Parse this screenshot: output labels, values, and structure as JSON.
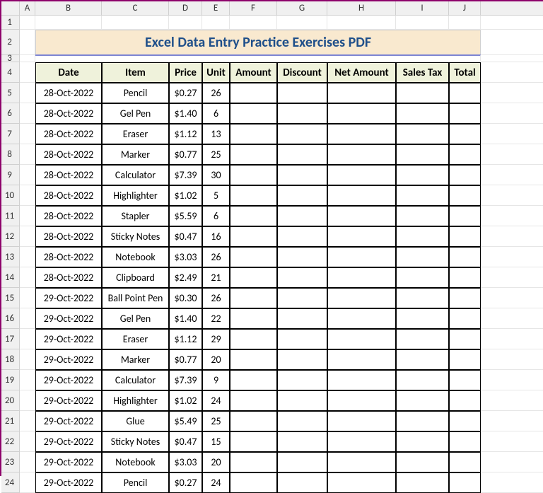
{
  "columns": [
    "A",
    "B",
    "C",
    "D",
    "E",
    "F",
    "G",
    "H",
    "I",
    "J"
  ],
  "title": "Excel Data Entry Practice Exercises PDF",
  "headers": [
    "Date",
    "Item",
    "Price",
    "Unit",
    "Amount",
    "Discount",
    "Net Amount",
    "Sales Tax",
    "Total"
  ],
  "rows": [
    {
      "n": 5,
      "date": "28-Oct-2022",
      "item": "Pencil",
      "price": "$0.27",
      "unit": "26"
    },
    {
      "n": 6,
      "date": "28-Oct-2022",
      "item": "Gel Pen",
      "price": "$1.40",
      "unit": "6"
    },
    {
      "n": 7,
      "date": "28-Oct-2022",
      "item": "Eraser",
      "price": "$1.12",
      "unit": "13"
    },
    {
      "n": 8,
      "date": "28-Oct-2022",
      "item": "Marker",
      "price": "$0.77",
      "unit": "25"
    },
    {
      "n": 9,
      "date": "28-Oct-2022",
      "item": "Calculator",
      "price": "$7.39",
      "unit": "30"
    },
    {
      "n": 10,
      "date": "28-Oct-2022",
      "item": "Highlighter",
      "price": "$1.02",
      "unit": "5"
    },
    {
      "n": 11,
      "date": "28-Oct-2022",
      "item": "Stapler",
      "price": "$5.59",
      "unit": "6"
    },
    {
      "n": 12,
      "date": "28-Oct-2022",
      "item": "Sticky Notes",
      "price": "$0.47",
      "unit": "16"
    },
    {
      "n": 13,
      "date": "28-Oct-2022",
      "item": "Notebook",
      "price": "$3.03",
      "unit": "26"
    },
    {
      "n": 14,
      "date": "28-Oct-2022",
      "item": "Clipboard",
      "price": "$2.49",
      "unit": "21"
    },
    {
      "n": 15,
      "date": "29-Oct-2022",
      "item": "Ball Point Pen",
      "price": "$0.30",
      "unit": "26"
    },
    {
      "n": 16,
      "date": "29-Oct-2022",
      "item": "Gel Pen",
      "price": "$1.40",
      "unit": "22"
    },
    {
      "n": 17,
      "date": "29-Oct-2022",
      "item": "Eraser",
      "price": "$1.12",
      "unit": "29"
    },
    {
      "n": 18,
      "date": "29-Oct-2022",
      "item": "Marker",
      "price": "$0.77",
      "unit": "20"
    },
    {
      "n": 19,
      "date": "29-Oct-2022",
      "item": "Calculator",
      "price": "$7.39",
      "unit": "9"
    },
    {
      "n": 20,
      "date": "29-Oct-2022",
      "item": "Highlighter",
      "price": "$1.02",
      "unit": "24"
    },
    {
      "n": 21,
      "date": "29-Oct-2022",
      "item": "Glue",
      "price": "$5.49",
      "unit": "25"
    },
    {
      "n": 22,
      "date": "29-Oct-2022",
      "item": "Sticky Notes",
      "price": "$0.47",
      "unit": "15"
    },
    {
      "n": 23,
      "date": "29-Oct-2022",
      "item": "Notebook",
      "price": "$3.03",
      "unit": "20"
    },
    {
      "n": 24,
      "date": "29-Oct-2022",
      "item": "Pencil",
      "price": "$0.27",
      "unit": "24"
    }
  ],
  "chart_data": {
    "type": "table",
    "title": "Excel Data Entry Practice Exercises PDF",
    "columns": [
      "Date",
      "Item",
      "Price",
      "Unit",
      "Amount",
      "Discount",
      "Net Amount",
      "Sales Tax",
      "Total"
    ],
    "data": [
      [
        "28-Oct-2022",
        "Pencil",
        0.27,
        26,
        null,
        null,
        null,
        null,
        null
      ],
      [
        "28-Oct-2022",
        "Gel Pen",
        1.4,
        6,
        null,
        null,
        null,
        null,
        null
      ],
      [
        "28-Oct-2022",
        "Eraser",
        1.12,
        13,
        null,
        null,
        null,
        null,
        null
      ],
      [
        "28-Oct-2022",
        "Marker",
        0.77,
        25,
        null,
        null,
        null,
        null,
        null
      ],
      [
        "28-Oct-2022",
        "Calculator",
        7.39,
        30,
        null,
        null,
        null,
        null,
        null
      ],
      [
        "28-Oct-2022",
        "Highlighter",
        1.02,
        5,
        null,
        null,
        null,
        null,
        null
      ],
      [
        "28-Oct-2022",
        "Stapler",
        5.59,
        6,
        null,
        null,
        null,
        null,
        null
      ],
      [
        "28-Oct-2022",
        "Sticky Notes",
        0.47,
        16,
        null,
        null,
        null,
        null,
        null
      ],
      [
        "28-Oct-2022",
        "Notebook",
        3.03,
        26,
        null,
        null,
        null,
        null,
        null
      ],
      [
        "28-Oct-2022",
        "Clipboard",
        2.49,
        21,
        null,
        null,
        null,
        null,
        null
      ],
      [
        "29-Oct-2022",
        "Ball Point Pen",
        0.3,
        26,
        null,
        null,
        null,
        null,
        null
      ],
      [
        "29-Oct-2022",
        "Gel Pen",
        1.4,
        22,
        null,
        null,
        null,
        null,
        null
      ],
      [
        "29-Oct-2022",
        "Eraser",
        1.12,
        29,
        null,
        null,
        null,
        null,
        null
      ],
      [
        "29-Oct-2022",
        "Marker",
        0.77,
        20,
        null,
        null,
        null,
        null,
        null
      ],
      [
        "29-Oct-2022",
        "Calculator",
        7.39,
        9,
        null,
        null,
        null,
        null,
        null
      ],
      [
        "29-Oct-2022",
        "Highlighter",
        1.02,
        24,
        null,
        null,
        null,
        null,
        null
      ],
      [
        "29-Oct-2022",
        "Glue",
        5.49,
        25,
        null,
        null,
        null,
        null,
        null
      ],
      [
        "29-Oct-2022",
        "Sticky Notes",
        0.47,
        15,
        null,
        null,
        null,
        null,
        null
      ],
      [
        "29-Oct-2022",
        "Notebook",
        3.03,
        20,
        null,
        null,
        null,
        null,
        null
      ],
      [
        "29-Oct-2022",
        "Pencil",
        0.27,
        24,
        null,
        null,
        null,
        null,
        null
      ]
    ]
  }
}
